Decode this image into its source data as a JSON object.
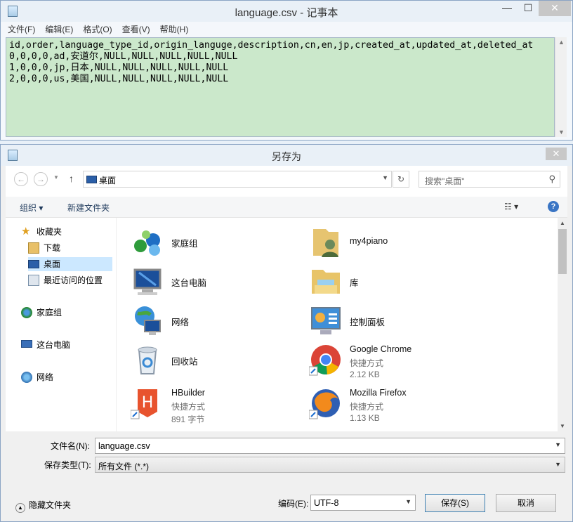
{
  "notepad": {
    "title": "language.csv - 记事本",
    "controls": {
      "minimize": "—",
      "maximize": "☐",
      "close": "✕"
    },
    "menu": [
      "文件(F)",
      "编辑(E)",
      "格式(O)",
      "查看(V)",
      "帮助(H)"
    ],
    "lines": [
      "id,order,language_type_id,origin_languge,description,cn,en,jp,created_at,updated_at,deleted_at",
      "0,0,0,0,ad,安道尔,NULL,NULL,NULL,NULL,NULL",
      "1,0,0,0,jp,日本,NULL,NULL,NULL,NULL,NULL",
      "2,0,0,0,us,美国,NULL,NULL,NULL,NULL,NULL"
    ]
  },
  "dialog": {
    "title": "另存为",
    "address": "桌面",
    "search_placeholder": "搜索\"桌面\"",
    "toolbar": {
      "organize": "组织 ▾",
      "new_folder": "新建文件夹"
    },
    "nav": [
      {
        "label": "收藏夹",
        "icon": "star-icon"
      },
      {
        "label": "下载",
        "icon": "download-folder-icon"
      },
      {
        "label": "桌面",
        "icon": "desktop-icon"
      },
      {
        "label": "最近访问的位置",
        "icon": "recent-places-icon"
      },
      {
        "label": "家庭组",
        "icon": "homegroup-icon"
      },
      {
        "label": "这台电脑",
        "icon": "computer-icon"
      },
      {
        "label": "网络",
        "icon": "network-icon"
      }
    ],
    "items": [
      {
        "name": "家庭组",
        "sub1": "",
        "sub2": ""
      },
      {
        "name": "my4piano",
        "sub1": "",
        "sub2": ""
      },
      {
        "name": "这台电脑",
        "sub1": "",
        "sub2": ""
      },
      {
        "name": "库",
        "sub1": "",
        "sub2": ""
      },
      {
        "name": "网络",
        "sub1": "",
        "sub2": ""
      },
      {
        "name": "控制面板",
        "sub1": "",
        "sub2": ""
      },
      {
        "name": "回收站",
        "sub1": "",
        "sub2": ""
      },
      {
        "name": "Google Chrome",
        "sub1": "快捷方式",
        "sub2": "2.12 KB"
      },
      {
        "name": "HBuilder",
        "sub1": "快捷方式",
        "sub2": "891 字节"
      },
      {
        "name": "Mozilla Firefox",
        "sub1": "快捷方式",
        "sub2": "1.13 KB"
      }
    ],
    "filename_label": "文件名(N):",
    "filename_value": "language.csv",
    "filetype_label": "保存类型(T):",
    "filetype_value": "所有文件  (*.*)",
    "encoding_label": "编码(E):",
    "encoding_value": "UTF-8",
    "save": "保存(S)",
    "cancel": "取消",
    "hide_folders": "隐藏文件夹"
  }
}
